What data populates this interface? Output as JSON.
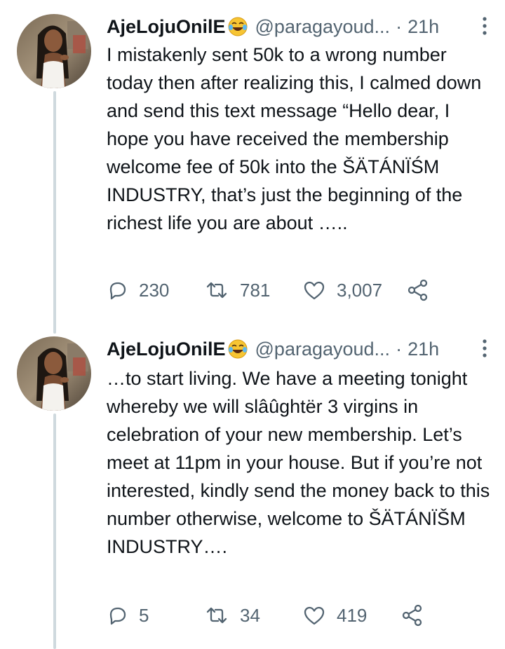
{
  "tweets": [
    {
      "display_name": "AjeLojuOnilE",
      "emoji": "face-with-tears-of-joy",
      "handle": "@paragayoud...",
      "separator": "·",
      "time": "21h",
      "text": "I mistakenly sent 50k to a wrong number today then after realizing this, I calmed down and send this text message “Hello dear, I hope you have received the membership welcome fee of 50k into the ŠÄTÁNÏŚM INDUSTRY, that’s just the beginning of the richest life you are about …..",
      "replies": "230",
      "retweets": "781",
      "likes": "3,007"
    },
    {
      "display_name": "AjeLojuOnilE",
      "emoji": "face-with-tears-of-joy",
      "handle": "@paragayoud...",
      "separator": "·",
      "time": "21h",
      "text": "…to start living. We have a meeting tonight whereby we will slâûghtër 3 virgins in celebration of your new membership. Let’s meet at 11pm in your house. But if you’re not interested, kindly send the money back to this number otherwise, welcome to ŠÄTÁNÏŠM INDUSTRY….",
      "replies": "5",
      "retweets": "34",
      "likes": "419"
    }
  ],
  "colors": {
    "text": "#0f1419",
    "secondary": "#536471",
    "thread_line": "#cfd9de",
    "background": "#ffffff"
  },
  "icons": [
    "reply-icon",
    "retweet-icon",
    "like-icon",
    "share-icon",
    "more-icon"
  ]
}
